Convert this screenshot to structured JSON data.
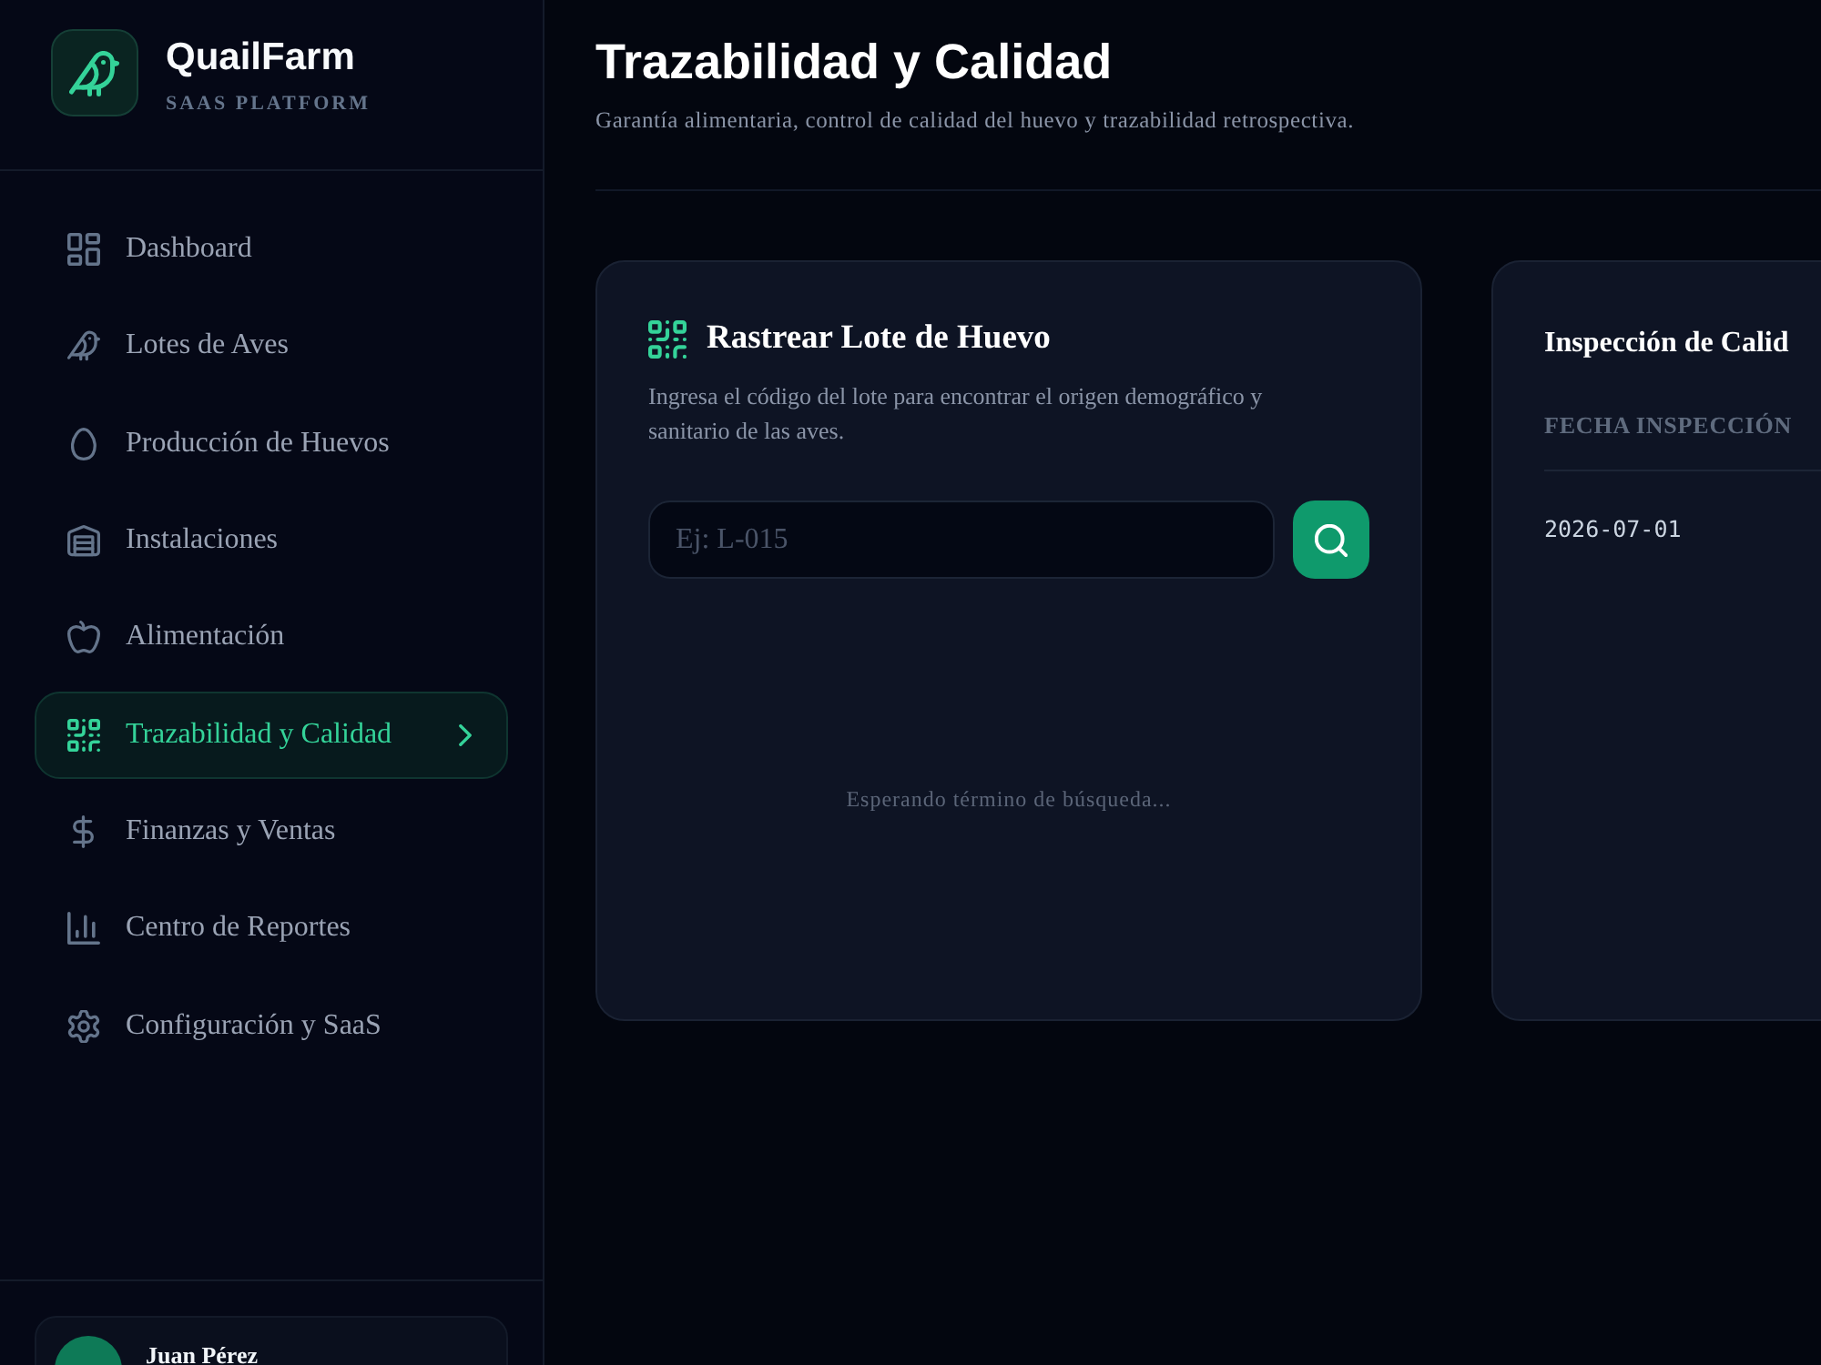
{
  "sidebar": {
    "brand": {
      "name": "QuailFarm",
      "tagline": "SAAS PLATFORM"
    },
    "nav": [
      {
        "label": "Dashboard",
        "selected": false
      },
      {
        "label": "Lotes de Aves",
        "selected": false
      },
      {
        "label": "Producción de Huevos",
        "selected": false
      },
      {
        "label": "Instalaciones",
        "selected": false
      },
      {
        "label": "Alimentación",
        "selected": false
      },
      {
        "label": "Trazabilidad y Calidad",
        "selected": true
      },
      {
        "label": "Finanzas y Ventas",
        "selected": false
      },
      {
        "label": "Centro de Reportes",
        "selected": false
      },
      {
        "label": "Configuración y SaaS",
        "selected": false
      }
    ],
    "user": {
      "name": "Juan Pérez"
    }
  },
  "header": {
    "title": "Trazabilidad y Calidad",
    "subtitle": "Garantía alimentaria, control de calidad del huevo y trazabilidad retrospectiva."
  },
  "trace_card": {
    "title": "Rastrear Lote de Huevo",
    "description": "Ingresa el código del lote para encontrar el origen demográfico y sanitario de las aves.",
    "search": {
      "placeholder": "Ej: L-015"
    },
    "empty_message": "Esperando término de búsqueda..."
  },
  "inspection_card": {
    "title": "Inspección de Calid",
    "table": {
      "columns": [
        "FECHA INSPECCIÓN"
      ],
      "rows": [
        [
          "2026-07-01"
        ]
      ]
    }
  }
}
